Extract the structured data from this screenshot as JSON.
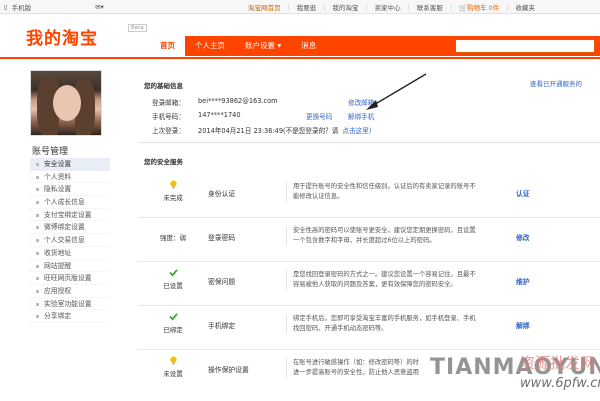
{
  "topbar": {
    "mobile": "手机版",
    "home": "淘宝网首页",
    "my_like": "我要逛",
    "my_taobao": "我的淘宝",
    "seller_center": "卖家中心",
    "support": "联系客服",
    "cart": "购物车 0件",
    "favorites": "收藏夹"
  },
  "header": {
    "logo": "我的淘宝",
    "beta": "Beta",
    "nav": [
      "首页",
      "个人主页",
      "账户设置 ▾",
      "消息"
    ]
  },
  "sidebar": {
    "title": "账号管理",
    "items": [
      "安全设置",
      "个人资料",
      "隐私设置",
      "个人成长信息",
      "支付宝绑定设置",
      "微博绑定设置",
      "个人交易信息",
      "收货地址",
      "网站提醒",
      "旺旺网页版设置",
      "应用授权",
      "实验室功能设置",
      "分享绑定"
    ]
  },
  "basic": {
    "title": "您的基础信息",
    "view_link": "查看已开通服务的",
    "email_label": "登录邮箱：",
    "email_value": "bei****93862@163.com",
    "email_action": "修改邮箱",
    "phone_label": "手机号码：",
    "phone_value": "147****1740",
    "phone_change": "更换号码",
    "phone_unbind": "解绑手机",
    "last_label": "上次登录：",
    "last_value": "2014年04月21日 23:36:49(不是您登录的？请",
    "last_link": "点击这里)"
  },
  "services": {
    "title": "您的安全服务",
    "rows": [
      {
        "status": "未完成",
        "name": "身份认证",
        "desc1": "用于提升账号的安全性和信任级别。认证后的有卖家记录的账号不",
        "desc2": "能修改认证信息。",
        "action": "认证"
      },
      {
        "status": "强度：弱",
        "name": "登录密码",
        "desc1": "安全性高的密码可以使账号更安全。建议您定期更换密码，且设置",
        "desc2": "一个包含数字和字母，并长度超过6位以上的密码。",
        "action": "修改"
      },
      {
        "status": "已设置",
        "name": "密保问题",
        "desc1": "是您找回登录密码的方式之一。建议您设置一个容易记住，且最不",
        "desc2": "容易被他人获取的问题及答案，更有效保障您的密码安全。",
        "action": "维护"
      },
      {
        "status": "已绑定",
        "name": "手机绑定",
        "desc1": "绑定手机后，您即可享受淘宝丰富的手机服务，如手机登录、手机",
        "desc2": "找回密码、开通手机动态密码等。",
        "action": "解绑"
      },
      {
        "status": "未设置",
        "name": "操作保护设置",
        "desc1": "在账号进行敏感操作（如：修改密码等）的时",
        "desc2": "进一步提高账号的安全性，防止他人恶意盗用",
        "action": ""
      }
    ]
  },
  "watermark": {
    "site": "TIANMAOYUN",
    "cn": "资源批发网",
    "url": "www.6pfw.cn"
  },
  "colors": {
    "brand": "#ff4400",
    "link": "#3366cc"
  }
}
